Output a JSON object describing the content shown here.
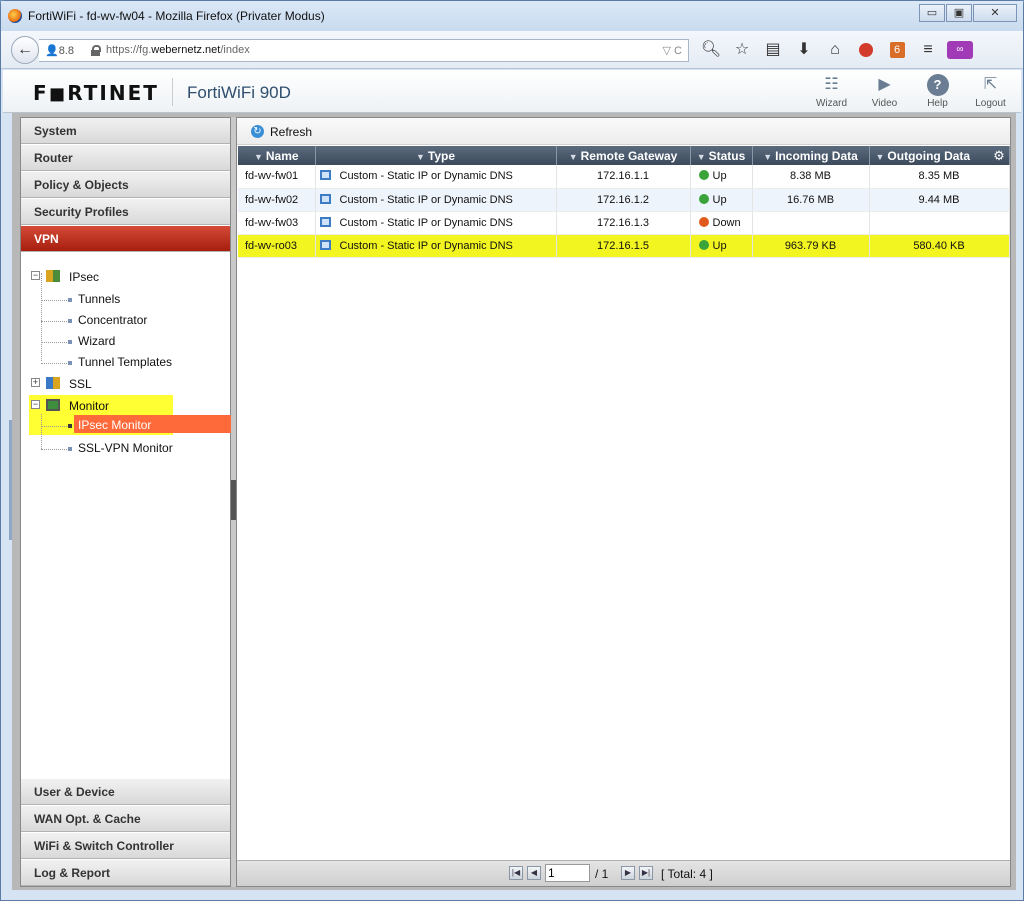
{
  "browser": {
    "window_title": "FortiWiFi - fd-wv-fw04 - Mozilla Firefox (Privater Modus)",
    "window_buttons": [
      "▭",
      "▣",
      "✕"
    ],
    "ext_badge": "8.8",
    "url_prefix": "https://fg.",
    "url_domain": "webernetz.net",
    "url_path": "/index",
    "url_right": "▽ C",
    "toolbar_icons": [
      "search-icon",
      "star-icon",
      "reader-icon",
      "download-icon",
      "home-icon",
      "adblock-icon",
      "addon-icon",
      "menu-icon",
      "private-mask-icon"
    ],
    "addon_badge": "6"
  },
  "header": {
    "logo": "F◼RTINET",
    "model": "FortiWiFi 90D",
    "tools": [
      {
        "name": "wizard",
        "label": "Wizard"
      },
      {
        "name": "video",
        "label": "Video"
      },
      {
        "name": "help",
        "label": "Help"
      },
      {
        "name": "logout",
        "label": "Logout"
      }
    ]
  },
  "sidebar": {
    "top_sections": [
      "System",
      "Router",
      "Policy & Objects",
      "Security Profiles",
      "VPN"
    ],
    "active_section": "VPN",
    "tree": {
      "ipsec": "IPsec",
      "ipsec_children": [
        "Tunnels",
        "Concentrator",
        "Wizard",
        "Tunnel Templates"
      ],
      "ssl": "SSL",
      "monitor": "Monitor",
      "monitor_children": [
        "IPsec Monitor",
        "SSL-VPN Monitor"
      ],
      "selected": "IPsec Monitor"
    },
    "bottom_sections": [
      "User & Device",
      "WAN Opt. & Cache",
      "WiFi & Switch Controller",
      "Log & Report"
    ]
  },
  "content": {
    "toolbar": {
      "refresh_label": "Refresh"
    },
    "columns": [
      "Name",
      "Type",
      "Remote Gateway",
      "Status",
      "Incoming Data",
      "Outgoing Data"
    ],
    "rows": [
      {
        "name": "fd-wv-fw01",
        "type": "Custom - Static IP or Dynamic DNS",
        "gateway": "172.16.1.1",
        "status": "Up",
        "incoming": "8.38 MB",
        "outgoing": "8.35 MB"
      },
      {
        "name": "fd-wv-fw02",
        "type": "Custom - Static IP or Dynamic DNS",
        "gateway": "172.16.1.2",
        "status": "Up",
        "incoming": "16.76 MB",
        "outgoing": "9.44 MB"
      },
      {
        "name": "fd-wv-fw03",
        "type": "Custom - Static IP or Dynamic DNS",
        "gateway": "172.16.1.3",
        "status": "Down",
        "incoming": "",
        "outgoing": ""
      },
      {
        "name": "fd-wv-ro03",
        "type": "Custom - Static IP or Dynamic DNS",
        "gateway": "172.16.1.5",
        "status": "Up",
        "incoming": "963.79 KB",
        "outgoing": "580.40 KB"
      }
    ],
    "highlight_color": "#f2f51f",
    "status_colors": {
      "up": "#3aa33a",
      "down": "#e05a1e"
    },
    "pager": {
      "page_value": "1",
      "page_of": "/ 1",
      "total": "[ Total: 4 ]"
    }
  }
}
